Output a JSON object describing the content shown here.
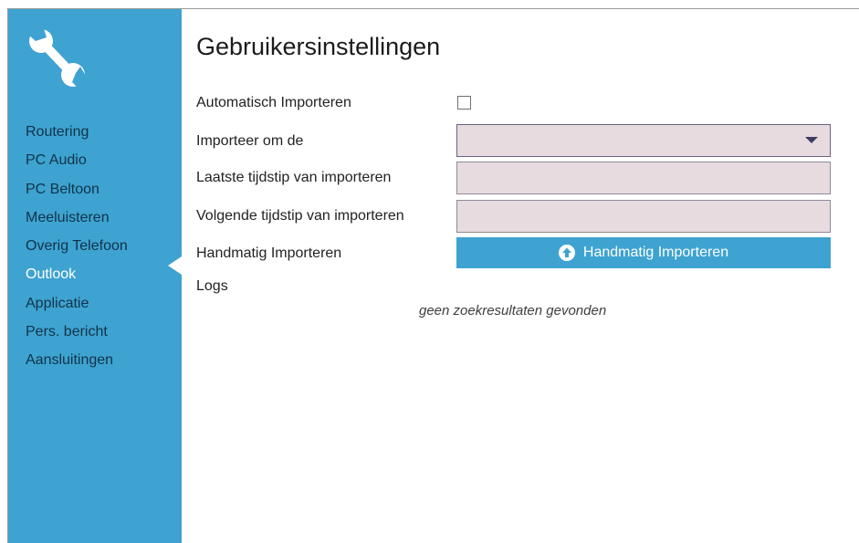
{
  "sidebar": {
    "logo_icon": "wrench-icon",
    "accent_color": "#3ea3d0",
    "items": [
      {
        "label": "Routering",
        "active": false
      },
      {
        "label": "PC Audio",
        "active": false
      },
      {
        "label": "PC Beltoon",
        "active": false
      },
      {
        "label": "Meeluisteren",
        "active": false
      },
      {
        "label": "Overig Telefoon",
        "active": false
      },
      {
        "label": "Outlook",
        "active": true
      },
      {
        "label": "Applicatie",
        "active": false
      },
      {
        "label": "Pers. bericht",
        "active": false
      },
      {
        "label": "Aansluitingen",
        "active": false
      }
    ]
  },
  "main": {
    "title": "Gebruikersinstellingen",
    "auto_import": {
      "label": "Automatisch Importeren",
      "checked": false
    },
    "interval": {
      "label": "Importeer om de",
      "value": ""
    },
    "last_import": {
      "label": "Laatste tijdstip van importeren",
      "value": ""
    },
    "next_import": {
      "label": "Volgende tijdstip van importeren",
      "value": ""
    },
    "manual_import": {
      "label": "Handmatig Importeren",
      "button_label": "Handmatig Importeren",
      "button_icon": "upload-arrow-icon"
    },
    "logs": {
      "label": "Logs",
      "empty_text": "geen zoekresultaten gevonden"
    }
  }
}
